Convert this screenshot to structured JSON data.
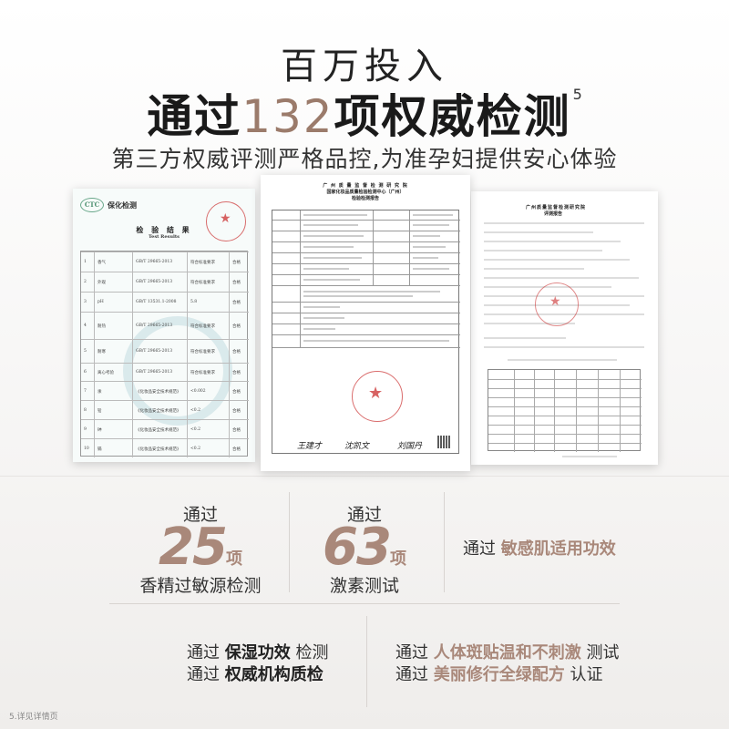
{
  "headline": {
    "line1": "百万投入",
    "line2_prefix": "通过",
    "line2_number": "132",
    "line2_suffix": "项权威检测",
    "line2_sup": "5",
    "line3": "第三方权威评测严格品控,为准孕妇提供安心体验"
  },
  "documents": {
    "left": {
      "logo": "CTC",
      "brand": "保化检测",
      "title": "检 验 结 果",
      "subtitle": "Test Results",
      "rows": [
        {
          "no": "1",
          "item": "香气",
          "std": "GB/T 29665-2013",
          "result": "符合标准要求",
          "judge": "合格"
        },
        {
          "no": "2",
          "item": "外观",
          "std": "GB/T 29665-2013",
          "result": "符合标准要求",
          "judge": "合格"
        },
        {
          "no": "3",
          "item": "pH",
          "std": "GB/T 13531.1-2008",
          "result": "5.8",
          "judge": "合格"
        },
        {
          "no": "4",
          "item": "耐热",
          "std": "GB/T 29665-2013",
          "result": "符合标准要求",
          "judge": "合格"
        },
        {
          "no": "5",
          "item": "耐寒",
          "std": "GB/T 29665-2013",
          "result": "符合标准要求",
          "judge": "合格"
        },
        {
          "no": "6",
          "item": "离心考验",
          "std": "GB/T 29665-2013",
          "result": "符合标准要求",
          "judge": "合格"
        },
        {
          "no": "7",
          "item": "汞",
          "std": "《化妆品安全技术规范》",
          "result": "<0.002",
          "judge": "合格"
        },
        {
          "no": "8",
          "item": "铅",
          "std": "《化妆品安全技术规范》",
          "result": "<0.2",
          "judge": "合格"
        },
        {
          "no": "9",
          "item": "砷",
          "std": "《化妆品安全技术规范》",
          "result": "<0.2",
          "judge": "合格"
        },
        {
          "no": "10",
          "item": "镉",
          "std": "《化妆品安全技术规范》",
          "result": "<0.2",
          "judge": "合格"
        }
      ]
    },
    "middle": {
      "title1": "广 州 质 量 监 督 检 测 研 究 院",
      "title2": "国家化妆品质量检验检测中心（广州）",
      "title3": "检验检测报告",
      "signatures": [
        "王建才",
        "沈凯文",
        "刘国丹"
      ]
    },
    "right": {
      "title1": "广州质量监督检测研究院",
      "title2": "评测报告"
    }
  },
  "stats": [
    {
      "pre": "通过",
      "number": "25",
      "unit": "项",
      "desc": "香精过敏源检测"
    },
    {
      "pre": "通过",
      "number": "63",
      "unit": "项",
      "desc": "激素测试"
    }
  ],
  "right_stat": {
    "pre": "通过",
    "highlight": "敏感肌适用功效"
  },
  "bottom_left": [
    {
      "pre": "通过",
      "highlight": "保湿功效",
      "post": "检测"
    },
    {
      "pre": "通过",
      "highlight": "权威机构质检",
      "post": ""
    }
  ],
  "bottom_right": [
    {
      "pre": "通过",
      "highlight": "人体斑贴温和不刺激",
      "post": "测试"
    },
    {
      "pre": "通过",
      "highlight": "美丽修行全绿配方",
      "post": "认证"
    }
  ],
  "footnote": "5.详见详情页"
}
